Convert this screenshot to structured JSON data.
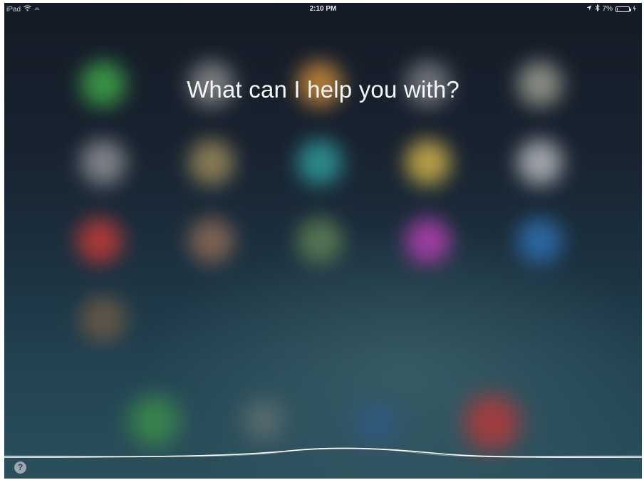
{
  "status_bar": {
    "device": "iPad",
    "time": "2:10 PM",
    "battery_percent": "7%",
    "battery_level": 0.07,
    "icons": [
      "wifi-icon",
      "activity-icon",
      "location-arrow-icon",
      "bluetooth-icon",
      "battery-icon",
      "charging-icon"
    ]
  },
  "siri": {
    "prompt": "What can I help you with?",
    "help_icon": "?"
  },
  "colors": {
    "prompt_text": "#f4f6f8",
    "waveform": "#ffffff",
    "background_top": "#141b27",
    "background_bottom": "#2b4f5b"
  },
  "blurred_home_icons": [
    {
      "name": "green",
      "color": "#3fa64a"
    },
    {
      "name": "gray-1",
      "color": "#8a8a8a"
    },
    {
      "name": "orange",
      "color": "#c9893a"
    },
    {
      "name": "gray-2",
      "color": "#7c7f84"
    },
    {
      "name": "gray-3",
      "color": "#9a9c8f"
    },
    {
      "name": "gray-4",
      "color": "#8f9195"
    },
    {
      "name": "multicolor",
      "color": "#9a8a5c"
    },
    {
      "name": "teal",
      "color": "#2f9a9a"
    },
    {
      "name": "yellow",
      "color": "#d1b34a"
    },
    {
      "name": "white-gray",
      "color": "#b8babd"
    },
    {
      "name": "red",
      "color": "#c23a37"
    },
    {
      "name": "rainbow",
      "color": "#8c6a56"
    },
    {
      "name": "olive",
      "color": "#5f7f55"
    },
    {
      "name": "magenta",
      "color": "#b23fb0"
    },
    {
      "name": "blue",
      "color": "#2f6fb0"
    },
    {
      "name": "brown",
      "color": "#6d5a45"
    }
  ],
  "blurred_dock_icons": [
    {
      "name": "dock-green",
      "color": "#3f9a4a"
    },
    {
      "name": "dock-gray",
      "color": "#6a7575"
    },
    {
      "name": "dock-blue",
      "color": "#2f5a8a"
    },
    {
      "name": "dock-red",
      "color": "#c83535"
    }
  ]
}
